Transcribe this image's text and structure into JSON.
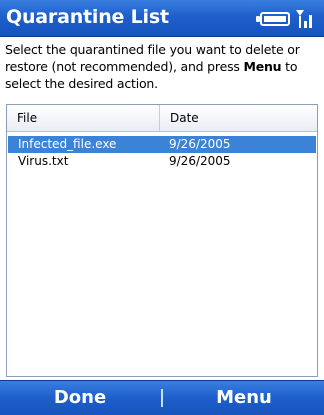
{
  "titlebar": {
    "title": "Quarantine List",
    "icons": [
      "battery-icon",
      "signal-icon"
    ]
  },
  "instructions": {
    "part1": "Select the quarantined file you want to delete or restore (not recommended), and press ",
    "bold": "Menu",
    "part2": " to select the desired action."
  },
  "list": {
    "columns": [
      "File",
      "Date"
    ],
    "rows": [
      {
        "file": "Infected_file.exe",
        "date": "9/26/2005",
        "selected": true
      },
      {
        "file": "Virus.txt",
        "date": "9/26/2005",
        "selected": false
      }
    ]
  },
  "softkeys": {
    "left": "Done",
    "right": "Menu"
  },
  "colors": {
    "titlebar": "#1e5fcb",
    "selection": "#3b83d6"
  }
}
